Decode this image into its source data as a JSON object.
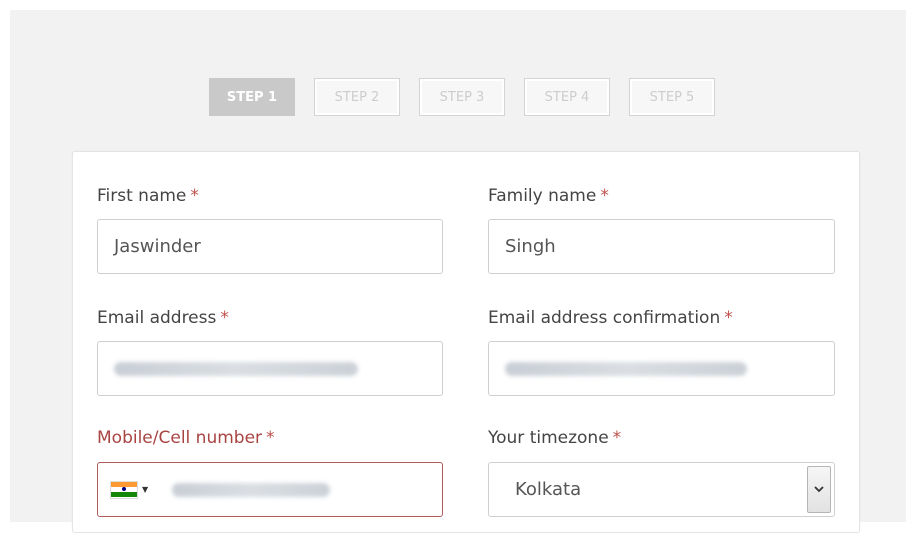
{
  "steps": [
    {
      "label": "STEP 1",
      "active": true
    },
    {
      "label": "STEP 2",
      "active": false
    },
    {
      "label": "STEP 3",
      "active": false
    },
    {
      "label": "STEP 4",
      "active": false
    },
    {
      "label": "STEP 5",
      "active": false
    }
  ],
  "form": {
    "first_name": {
      "label": "First name",
      "required": "*",
      "value": "Jaswinder"
    },
    "family_name": {
      "label": "Family name",
      "required": "*",
      "value": "Singh"
    },
    "email": {
      "label": "Email address",
      "required": "*",
      "value": ""
    },
    "email_confirm": {
      "label": "Email address confirmation",
      "required": "*",
      "value": ""
    },
    "mobile": {
      "label": "Mobile/Cell number",
      "required": "*",
      "value": "",
      "country_flag": "india-flag-icon"
    },
    "timezone": {
      "label": "Your timezone",
      "required": "*",
      "value": "Kolkata"
    }
  },
  "colors": {
    "required_star": "#c0504d",
    "error_label": "#a94442",
    "active_step_bg": "#c9c9c9"
  }
}
